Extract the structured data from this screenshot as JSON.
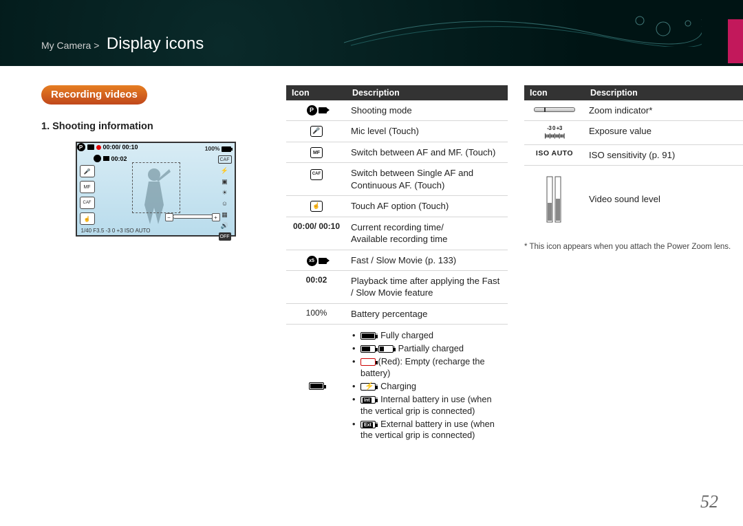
{
  "breadcrumb_prefix": "My Camera >",
  "page_title": "Display icons",
  "section_pill": "Recording videos",
  "section_heading": "1. Shooting information",
  "page_number": "52",
  "footnote": "* This icon appears when you attach the Power Zoom lens.",
  "headers": {
    "icon": "Icon",
    "desc": "Description"
  },
  "cam": {
    "rec_time": "00:00/ 00:10",
    "pb_time": "00:02",
    "batt_pct": "100%",
    "bottom": "1/40    F3.5    -3        0       +3    ISO AUTO"
  },
  "table1": [
    {
      "desc": "Shooting mode"
    },
    {
      "desc": "Mic level (Touch)"
    },
    {
      "desc": "Switch between AF and MF. (Touch)"
    },
    {
      "desc": "Switch between Single AF and Continuous AF. (Touch)"
    },
    {
      "desc": "Touch AF option (Touch)"
    },
    {
      "icon_text": "00:00/ 00:10",
      "desc": "Current recording time/\nAvailable recording time"
    },
    {
      "desc": "Fast / Slow Movie (p. 133)"
    },
    {
      "icon_text": "00:02",
      "desc": "Playback time after applying the Fast / Slow Movie feature"
    },
    {
      "icon_text": "100%",
      "desc": "Battery percentage"
    }
  ],
  "battery_states": {
    "full": ": Fully charged",
    "partial": ": Partially charged",
    "empty": " (Red): Empty (recharge the battery)",
    "charging": ": Charging",
    "internal": ": Internal battery in use (when the vertical grip is connected)",
    "external": ": External battery in use (when the vertical grip is connected)"
  },
  "table2": [
    {
      "desc": "Zoom indicator*"
    },
    {
      "icon_text": "-3   0   +3",
      "desc": "Exposure value"
    },
    {
      "icon_text": "ISO AUTO",
      "desc": "ISO sensitivity (p. 91)"
    },
    {
      "desc": "Video sound level"
    }
  ]
}
